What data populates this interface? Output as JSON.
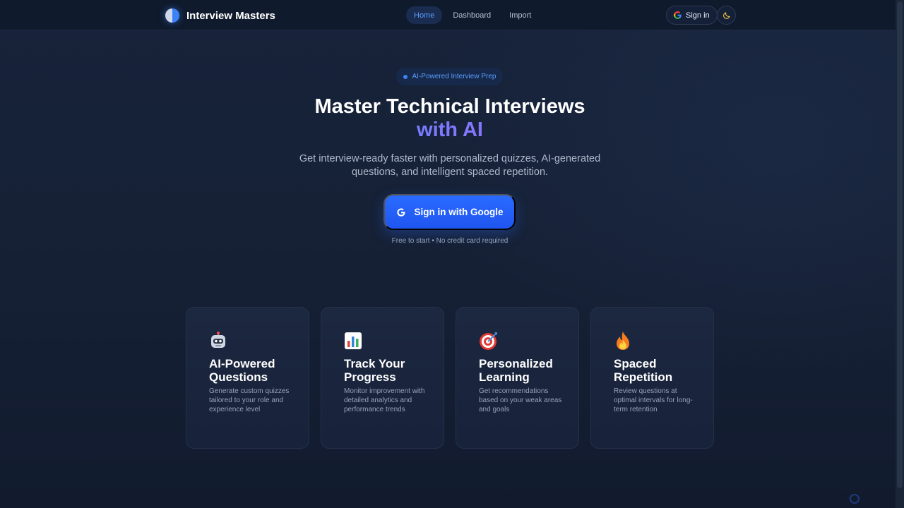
{
  "header": {
    "brand": "Interview Masters",
    "nav": [
      {
        "label": "Home",
        "active": true
      },
      {
        "label": "Dashboard",
        "active": false
      },
      {
        "label": "Import",
        "active": false
      }
    ],
    "signin_label": "Sign in",
    "theme_icon": "moon-icon"
  },
  "hero": {
    "badge": "AI-Powered Interview Prep",
    "title_line1": "Master Technical Interviews",
    "title_line2": "with AI",
    "subtitle": "Get interview-ready faster with personalized quizzes, AI-generated questions, and intelligent spaced repetition.",
    "cta_label": "Sign in with Google",
    "cta_note": "Free to start • No credit card required"
  },
  "features": [
    {
      "icon": "robot-icon",
      "title": "AI-Powered Questions",
      "desc": "Generate custom quizzes tailored to your role and experience level"
    },
    {
      "icon": "bar-chart-icon",
      "title": "Track Your Progress",
      "desc": "Monitor improvement with detailed analytics and performance trends"
    },
    {
      "icon": "target-icon",
      "title": "Personalized Learning",
      "desc": "Get recommendations based on your weak areas and goals"
    },
    {
      "icon": "fire-icon",
      "title": "Spaced Repetition",
      "desc": "Review questions at optimal intervals for long-term retention"
    }
  ],
  "colors": {
    "accent": "#2a6bff",
    "background": "#162136",
    "gradient_start": "#5b8cff",
    "gradient_end": "#a366ff"
  }
}
